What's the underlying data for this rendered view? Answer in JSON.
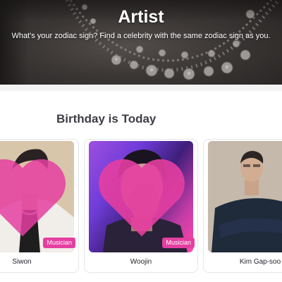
{
  "hero": {
    "title": "Artist",
    "subtitle": "What's your zodiac sign? Find a celebrity with the same zodiac sign as you."
  },
  "section": {
    "title": "Birthday is Today"
  },
  "cards": [
    {
      "name": "Siwon",
      "tag": "Musician",
      "favorite_icon": "heart-icon"
    },
    {
      "name": "Woojin",
      "tag": "Musician",
      "favorite_icon": "heart-icon"
    },
    {
      "name": "Kim Gap-soo",
      "tag": "",
      "favorite_icon": ""
    }
  ],
  "colors": {
    "tag_bg": "#e53ea1",
    "heart": "#e53ea1",
    "title_text": "#3d3d46"
  }
}
